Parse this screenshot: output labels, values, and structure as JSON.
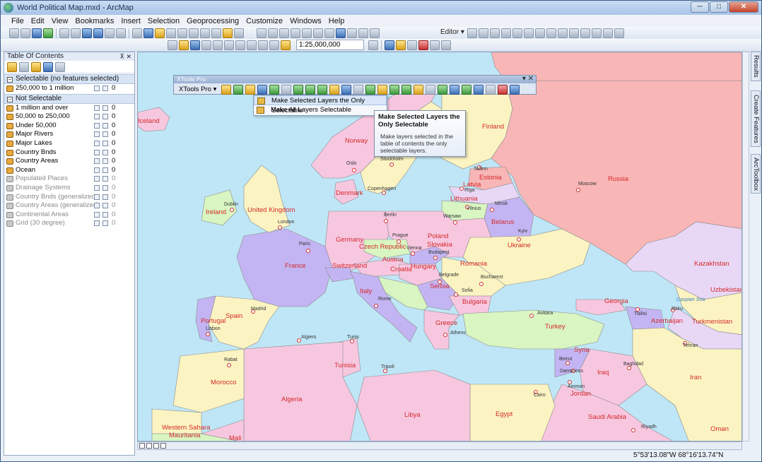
{
  "window": {
    "title": "World Political Map.mxd - ArcMap",
    "min": "─",
    "max": "□",
    "close": "✕"
  },
  "menubar": [
    "File",
    "Edit",
    "View",
    "Bookmarks",
    "Insert",
    "Selection",
    "Geoprocessing",
    "Customize",
    "Windows",
    "Help"
  ],
  "toolbar": {
    "scale": "1:25,000,000",
    "editor_label": "Editor ▾"
  },
  "toc": {
    "title": "Table Of Contents",
    "pin": "⊼ ✕",
    "groups": [
      {
        "label": "Selectable (no features selected)",
        "toggle": "−"
      },
      {
        "label": "Not Selectable",
        "toggle": "−"
      }
    ],
    "layers": [
      {
        "name": "250,000 to 1 million",
        "count": "0",
        "dim": false
      },
      {
        "name": "1 million and over",
        "count": "0",
        "dim": false
      },
      {
        "name": "50,000 to 250,000",
        "count": "0",
        "dim": false
      },
      {
        "name": "Under 50,000",
        "count": "0",
        "dim": false
      },
      {
        "name": "Major Rivers",
        "count": "0",
        "dim": false
      },
      {
        "name": "Major Lakes",
        "count": "0",
        "dim": false
      },
      {
        "name": "Country Bnds",
        "count": "0",
        "dim": false
      },
      {
        "name": "Country Areas",
        "count": "0",
        "dim": false
      },
      {
        "name": "Ocean",
        "count": "0",
        "dim": false
      },
      {
        "name": "Populated Places",
        "count": "0",
        "dim": true
      },
      {
        "name": "Drainage Systems",
        "count": "0",
        "dim": true
      },
      {
        "name": "Country Bnds (generalized)",
        "count": "0",
        "dim": true
      },
      {
        "name": "Country Areas (generalized)",
        "count": "0",
        "dim": true
      },
      {
        "name": "Continental Areas",
        "count": "0",
        "dim": true
      },
      {
        "name": "Grid (30 degree)",
        "count": "0",
        "dim": true
      }
    ]
  },
  "xtools": {
    "title": "XTools Pro",
    "close": "▾ ✕",
    "menu_button": "XTools Pro ▾",
    "menu": [
      {
        "label": "Make Selected Layers the Only Selectable",
        "highlighted": true
      },
      {
        "label": "Make All Layers Selectable",
        "highlighted": false
      }
    ],
    "tooltip": {
      "title": "Make Selected Layers the Only Selectable",
      "body": "Make layers selected in the table of contents the only selectable layers."
    }
  },
  "map": {
    "countries": [
      "Iceland",
      "Norway",
      "Finland",
      "Russia",
      "Estonia",
      "Latvia",
      "Lithuania",
      "Belarus",
      "Denmark",
      "Ireland",
      "United Kingdom",
      "Germany",
      "Poland",
      "Czech Republic",
      "Slovakia",
      "Ukraine",
      "France",
      "Switzerland",
      "Austria",
      "Hungary",
      "Romania",
      "Croatia",
      "Serbia",
      "Italy",
      "Bulgaria",
      "Spain",
      "Portugal",
      "Greece",
      "Turkey",
      "Georgia",
      "Azerbaijan",
      "Kazakhstan",
      "Uzbekistan",
      "Turkmenistan",
      "Syria",
      "Iraq",
      "Iran",
      "Jordan",
      "Tunisia",
      "Morocco",
      "Algeria",
      "Libya",
      "Egypt",
      "Saudi Arabia",
      "Western Sahara",
      "Mauritania",
      "Oman",
      "Mali"
    ],
    "cities": [
      "Oslo",
      "Stockholm",
      "Tallinn",
      "Riga",
      "Copenhagen",
      "Moscow",
      "Minsk",
      "Vilnius",
      "Berlin",
      "Warsaw",
      "Kyiv",
      "London",
      "Dublin",
      "Paris",
      "Prague",
      "Vienna",
      "Budapest",
      "Belgrade",
      "Bucharest",
      "Sofia",
      "Rome",
      "Madrid",
      "Lisbon",
      "Athens",
      "Ankara",
      "Baku",
      "Tbilisi",
      "Algiers",
      "Tunis",
      "Tripoli",
      "Rabat",
      "Beirut",
      "Damascus",
      "Baghdad",
      "Tehran",
      "Amman",
      "Cairo",
      "Riyadh",
      "Caspian Sea"
    ]
  },
  "sidetabs": [
    "Results",
    "Create Features",
    "ArcToolbox"
  ],
  "status": {
    "coords": "5°53'13.08\"W  68°16'13.74\"N"
  }
}
